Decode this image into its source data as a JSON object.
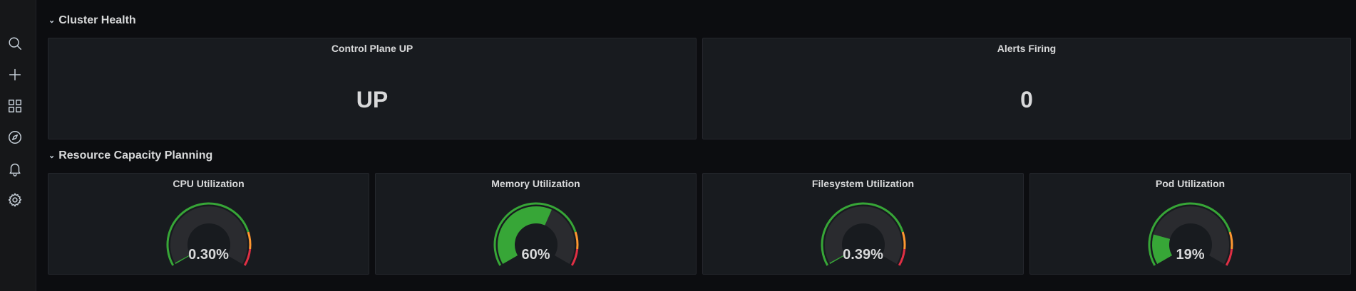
{
  "sidebar": {
    "items": [
      {
        "name": "search-icon"
      },
      {
        "name": "plus-icon"
      },
      {
        "name": "dashboards-icon"
      },
      {
        "name": "explore-compass-icon"
      },
      {
        "name": "alerting-bell-icon"
      },
      {
        "name": "settings-gear-icon"
      }
    ]
  },
  "rows": [
    {
      "title": "Cluster Health",
      "chevron": "⌄"
    },
    {
      "title": "Resource Capacity Planning",
      "chevron": "⌄"
    }
  ],
  "stat_panels": [
    {
      "title": "Control Plane UP",
      "value": "UP"
    },
    {
      "title": "Alerts Firing",
      "value": "0"
    }
  ],
  "gauges": [
    {
      "title": "CPU Utilization",
      "display": "0.30%",
      "percent": 0.3
    },
    {
      "title": "Memory Utilization",
      "display": "60%",
      "percent": 60
    },
    {
      "title": "Filesystem Utilization",
      "display": "0.39%",
      "percent": 0.39
    },
    {
      "title": "Pod Utilization",
      "display": "19%",
      "percent": 19
    }
  ],
  "colors": {
    "background": "#0c0d10",
    "panel": "#181b1f",
    "gauge_fill": "#37a637",
    "gauge_track": "#2a2b2f",
    "threshold_green": "#37a637",
    "threshold_orange": "#ff9830",
    "threshold_red": "#e02f44"
  }
}
